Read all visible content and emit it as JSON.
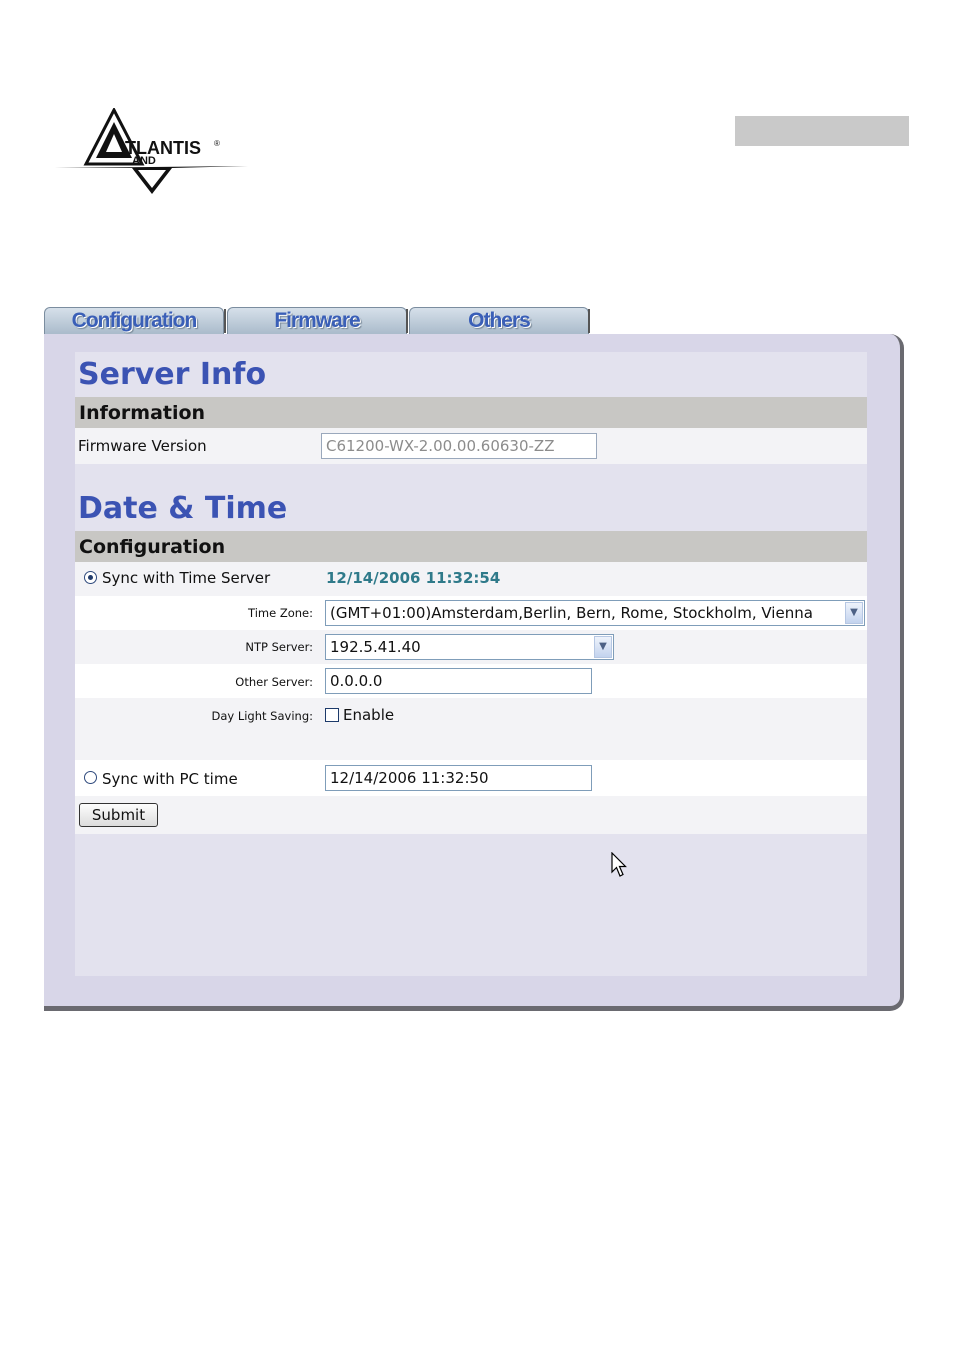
{
  "header": {
    "logo_text": "TLANTIS",
    "logo_subtext": "AND"
  },
  "tabs": [
    {
      "label": "Configuration"
    },
    {
      "label": "Firmware"
    },
    {
      "label": "Others"
    }
  ],
  "server_info": {
    "title": "Server Info",
    "section": "Information",
    "firmware_label": "Firmware Version",
    "firmware_value": "C61200-WX-2.00.00.60630-ZZ"
  },
  "date_time": {
    "title": "Date & Time",
    "section": "Configuration",
    "sync_time_server_label": "Sync with Time Server",
    "sync_time_server_selected": true,
    "current_time": "12/14/2006 11:32:54",
    "time_zone_label": "Time Zone:",
    "time_zone_value": "(GMT+01:00)Amsterdam,Berlin, Bern, Rome, Stockholm, Vienna",
    "ntp_server_label": "NTP Server:",
    "ntp_server_value": "192.5.41.40",
    "other_server_label": "Other Server:",
    "other_server_value": "0.0.0.0",
    "daylight_label": "Day Light Saving:",
    "daylight_enable_label": "Enable",
    "daylight_checked": false,
    "sync_pc_label": "Sync with PC time",
    "pc_time_value": "12/14/2006 11:32:50",
    "submit_label": "Submit"
  }
}
